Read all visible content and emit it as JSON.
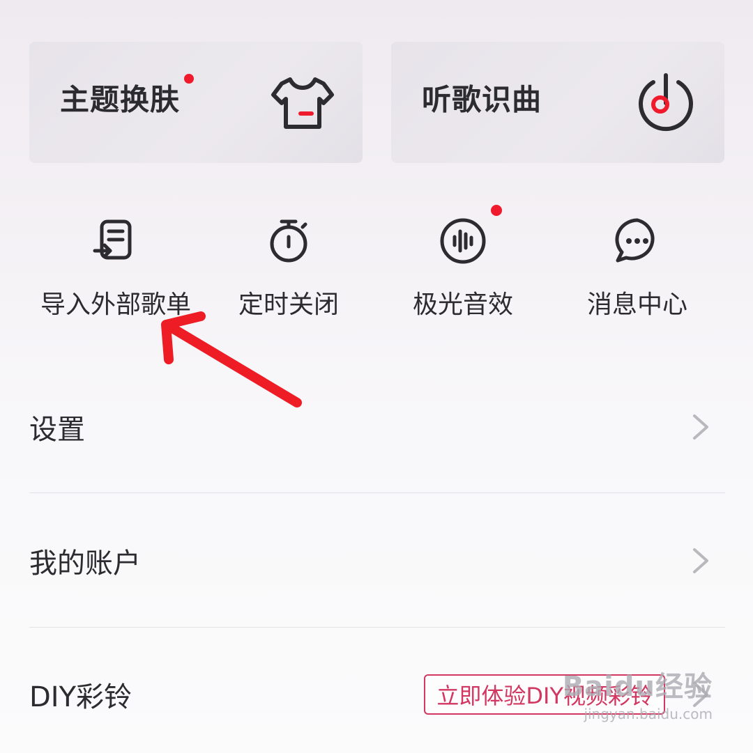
{
  "cards": [
    {
      "title": "主题换肤",
      "icon": "tshirt-icon",
      "has_dot": true
    },
    {
      "title": "听歌识曲",
      "icon": "music-recognize-icon",
      "has_dot": false
    }
  ],
  "actions": [
    {
      "label": "导入外部歌单",
      "icon": "import-playlist-icon",
      "has_dot": false
    },
    {
      "label": "定时关闭",
      "icon": "timer-icon",
      "has_dot": false
    },
    {
      "label": "极光音效",
      "icon": "sound-wave-icon",
      "has_dot": true
    },
    {
      "label": "消息中心",
      "icon": "chat-bubble-icon",
      "has_dot": false
    }
  ],
  "list": [
    {
      "label": "设置"
    },
    {
      "label": "我的账户"
    },
    {
      "label": "DIY彩铃",
      "promo": "立即体验DIY视频彩铃"
    }
  ],
  "watermark": {
    "logo": "Baidu经验",
    "url": "jingyan.baidu.com"
  },
  "colors": {
    "accent_red": "#ef1b2c",
    "promo_pink": "#d13760",
    "annotation_red": "#ee1c25"
  }
}
